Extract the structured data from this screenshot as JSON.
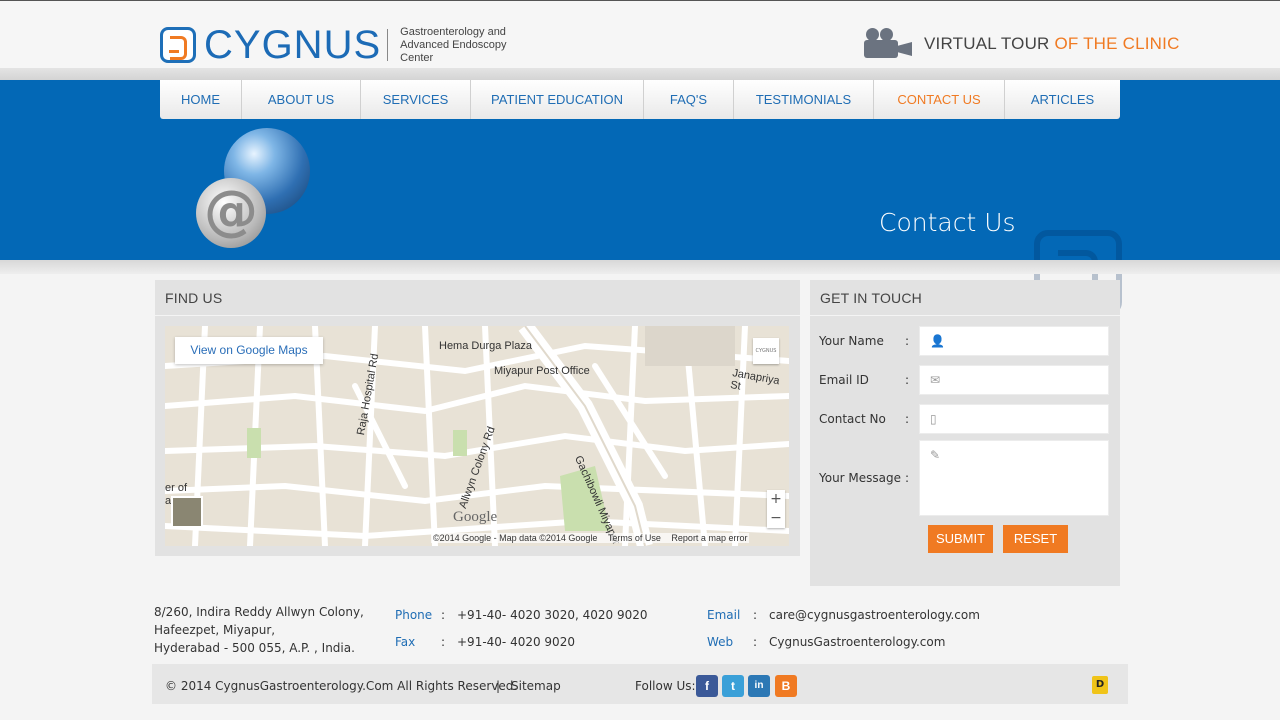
{
  "header": {
    "brand": "CYGNUS",
    "tagline_line1": "Gastroenterology and",
    "tagline_line2": "Advanced Endoscopy Center",
    "virtual_tour_prefix": "VIRTUAL TOUR",
    "virtual_tour_suffix": "OF THE CLINIC"
  },
  "nav": {
    "items": [
      {
        "label": "HOME"
      },
      {
        "label": "ABOUT US"
      },
      {
        "label": "SERVICES"
      },
      {
        "label": "PATIENT EDUCATION"
      },
      {
        "label": "FAQ'S"
      },
      {
        "label": "TESTIMONIALS"
      },
      {
        "label": "CONTACT US",
        "active": true
      },
      {
        "label": "ARTICLES"
      }
    ]
  },
  "banner": {
    "title": "Contact Us"
  },
  "find_us": {
    "heading": "FIND US",
    "map": {
      "view_button": "View on Google Maps",
      "places": [
        "Hema Durga Plaza",
        "Miyapur Post Office",
        "Raja Hospital Rd",
        "Allwyn Colony Rd",
        "Gachibowli Miyapur",
        "Janapriya St",
        "er of",
        "a"
      ],
      "google_mark": "Google",
      "attribution": "©2014 Google - Map data ©2014 Google",
      "terms": "Terms of Use",
      "report": "Report a map error",
      "zoom_in": "+",
      "zoom_out": "−",
      "corner_label": "CYGNUS"
    }
  },
  "get_in_touch": {
    "heading": "GET IN TOUCH",
    "fields": [
      {
        "label": "Your Name",
        "icon": "user-icon",
        "glyph": "👤",
        "value": ""
      },
      {
        "label": "Email ID",
        "icon": "mail-icon",
        "glyph": "✉",
        "value": ""
      },
      {
        "label": "Contact No",
        "icon": "phone-icon",
        "glyph": "▯",
        "value": ""
      },
      {
        "label": "Your Message",
        "icon": "pen-icon",
        "glyph": "✎",
        "value": ""
      }
    ],
    "colon": ":",
    "submit": "SUBMIT",
    "reset": "RESET"
  },
  "contact_info": {
    "address_line1": "8/260, Indira Reddy Allwyn Colony,",
    "address_line2": "Hafeezpet, Miyapur,",
    "address_line3": "Hyderabad - 500 055, A.P. , India.",
    "phone_label": "Phone",
    "phone_value": "+91-40- 4020 3020, 4020 9020",
    "fax_label": "Fax",
    "fax_value": "+91-40- 4020 9020",
    "email_label": "Email",
    "email_value": "care@cygnusgastroenterology.com",
    "web_label": "Web",
    "web_value": "CygnusGastroenterology.com",
    "colon": ":"
  },
  "footer": {
    "copyright": "© 2014 CygnusGastroenterology.Com All Rights Reserved.",
    "separator": "|",
    "sitemap": "Sitemap",
    "follow_us": "Follow Us:",
    "social": [
      {
        "name": "facebook-icon",
        "glyph": "f",
        "color": "#3b5998"
      },
      {
        "name": "twitter-icon",
        "glyph": "t",
        "color": "#3aa0d8"
      },
      {
        "name": "linkedin-icon",
        "glyph": "in",
        "color": "#2c78b5"
      },
      {
        "name": "blogger-icon",
        "glyph": "B",
        "color": "#f07a22"
      }
    ]
  },
  "colors": {
    "brand_blue": "#0368b6",
    "accent_orange": "#f07a22",
    "link_blue": "#1f6db4"
  }
}
